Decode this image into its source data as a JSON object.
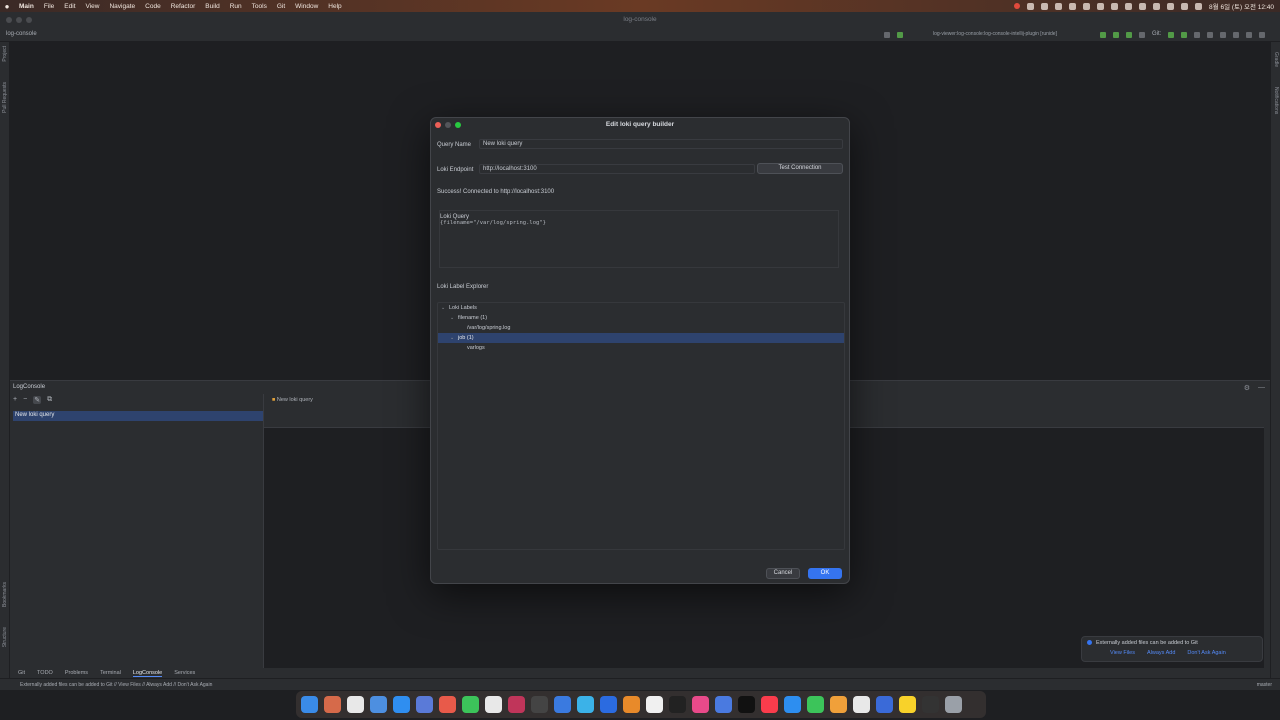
{
  "menubar": {
    "apple": "",
    "items": [
      "Main",
      "File",
      "Edit",
      "View",
      "Navigate",
      "Code",
      "Refactor",
      "Build",
      "Run",
      "Tools",
      "Git",
      "Window",
      "Help"
    ],
    "clock": "8월 6일 (토) 오전 12:40"
  },
  "window": {
    "title": "log-console"
  },
  "toolbar": {
    "project": "log-console",
    "run_config": "log-viewer:log-console:log-console-intellij-plugin [runide]",
    "git_label": "Git:"
  },
  "left_strip": {
    "project": "Project",
    "pull_requests": "Pull Requests",
    "bookmarks": "Bookmarks",
    "structure": "Structure"
  },
  "right_strip": {
    "gradle": "Gradle",
    "notifications": "Notifications"
  },
  "logconsole": {
    "title": "LogConsole",
    "selected_query": "New loki query",
    "tab_label": "New loki query"
  },
  "status_tabs": {
    "git": "Git",
    "todo": "TODO",
    "problems": "Problems",
    "terminal": "Terminal",
    "logconsole": "LogConsole",
    "services": "Services"
  },
  "statusbar": {
    "message": "Externally added files can be added to Git // View Files // Always Add // Don't Ask Again",
    "branch": "master"
  },
  "dialog": {
    "title": "Edit loki query builder",
    "query_name_label": "Query Name",
    "query_name_value": "New loki query",
    "endpoint_label": "Loki Endpoint",
    "endpoint_value": "http://localhost:3100",
    "test_button": "Test Connection",
    "success": "Success! Connected to http://localhost:3100",
    "query_label": "Loki Query",
    "query_value": "{filename=\"/var/log/spring.log\"}",
    "explorer_label": "Loki Label Explorer",
    "tree": {
      "root": "Loki Labels",
      "filename": "filename (1)",
      "filename_value": "/var/log/spring.log",
      "job": "job (1)",
      "job_value": "varlogs"
    },
    "cancel": "Cancel",
    "ok": "OK"
  },
  "notification": {
    "text": "Externally added files can be added to Git",
    "view_files": "View Files",
    "always_add": "Always Add",
    "dont_ask": "Don't Ask Again"
  },
  "colors": {
    "accent": "#3574f0",
    "selection": "#2e436e",
    "background": "#1e1f22",
    "panel": "#2b2d30"
  }
}
